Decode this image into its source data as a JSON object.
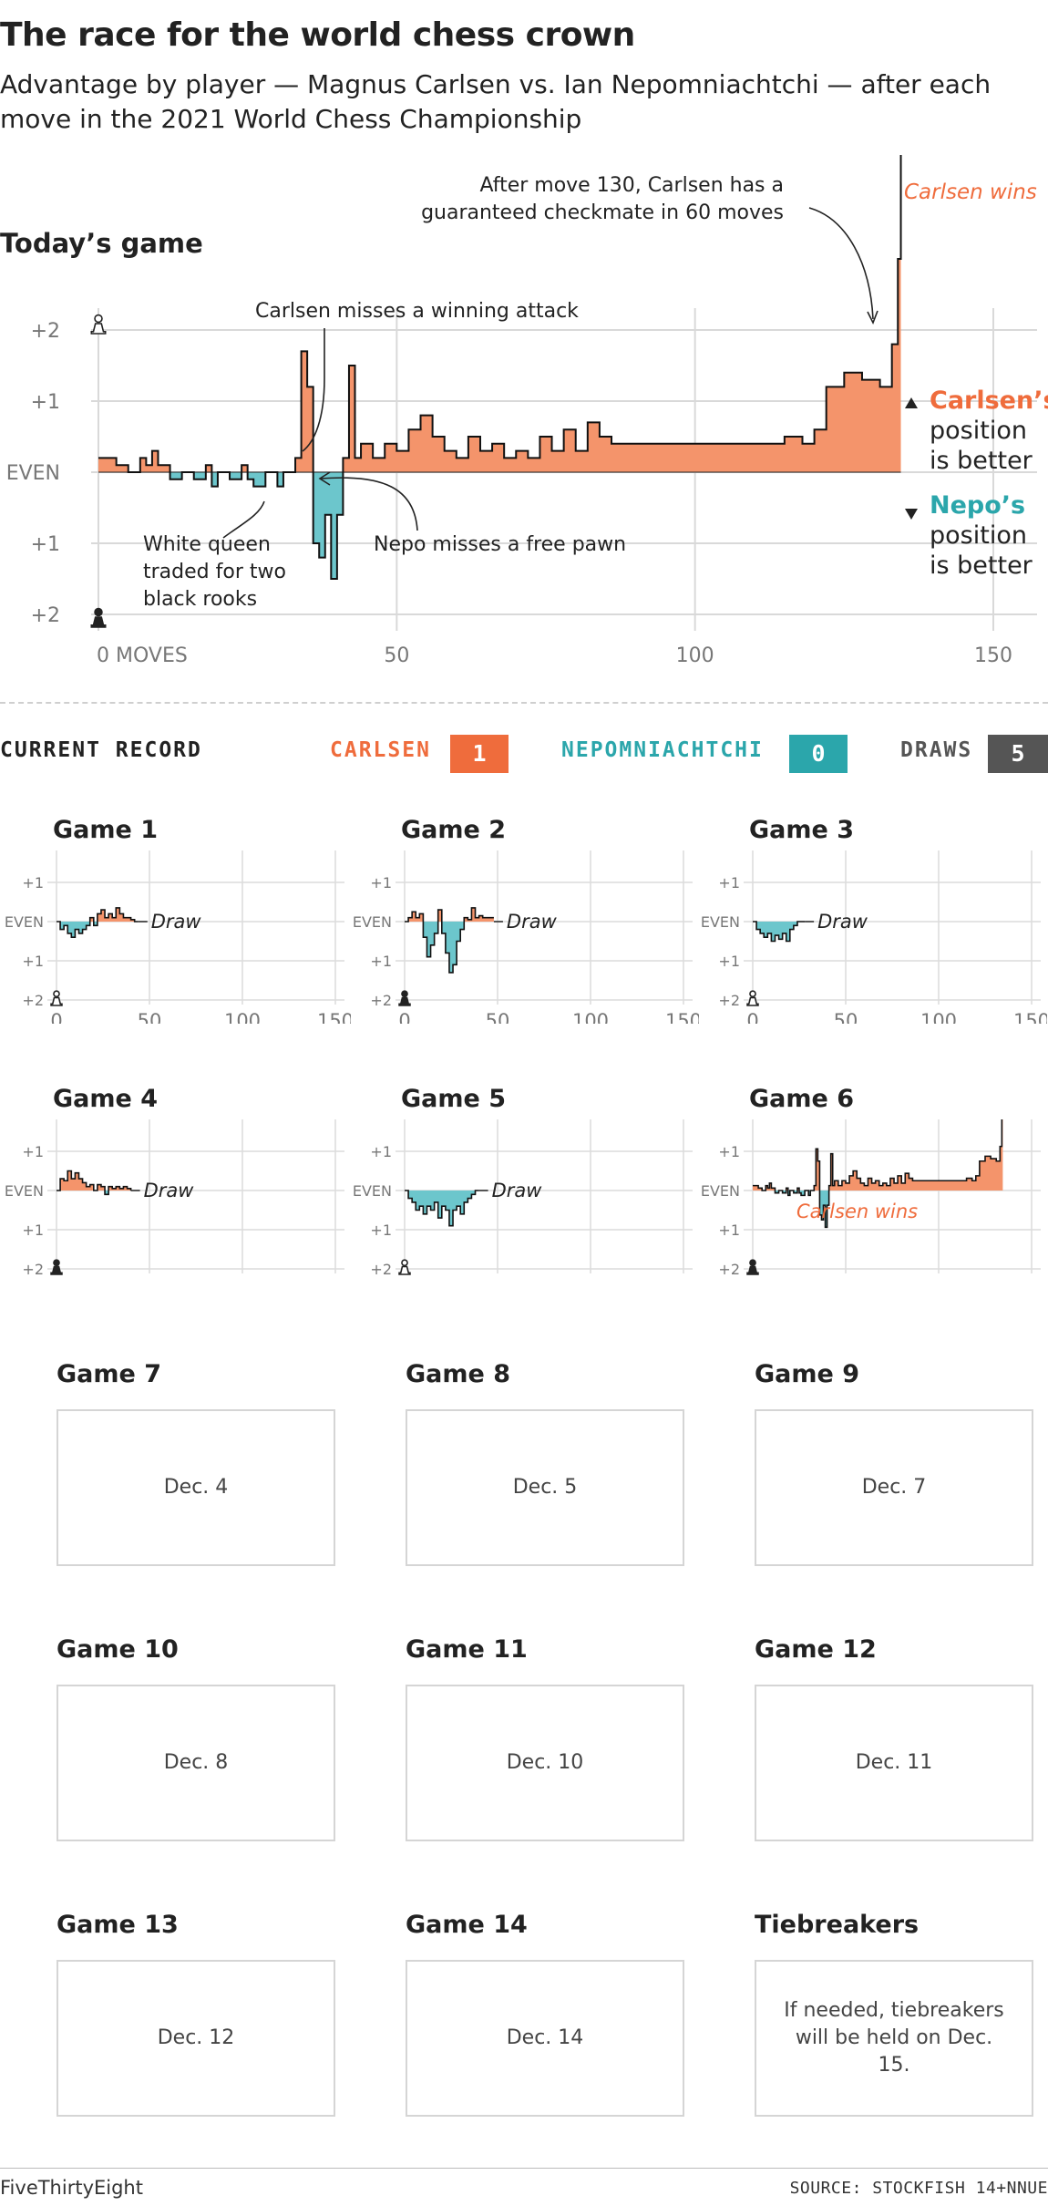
{
  "header": {
    "title": "The race for the world chess crown",
    "subtitle": "Advantage by player — Magnus Carlsen vs. Ian Nepomniachtchi — after each move in the 2021 World Chess Championship",
    "today_label": "Today’s game"
  },
  "colors": {
    "carlsen": "#f4946b",
    "carlsen_text": "#ef6c3c",
    "nepo": "#6cc6cc",
    "nepo_text": "#2ba6ab",
    "draw": "#555555"
  },
  "chart_data": {
    "type": "area",
    "title": "Today’s game",
    "xlabel": "MOVES",
    "x_ticks": [
      "0 MOVES",
      "50",
      "100",
      "150"
    ],
    "y_ticks": [
      "+2",
      "+1",
      "EVEN",
      "+1",
      "+2"
    ],
    "xlim": [
      0,
      150
    ],
    "ylim": [
      -2,
      2
    ],
    "legend_carlsen": [
      "Carlsen’s",
      "position",
      "is better"
    ],
    "legend_nepo": [
      "Nepo’s",
      "position",
      "is better"
    ],
    "result_label": "Carlsen wins",
    "annotations": {
      "checkmate": [
        "After move 130, Carlsen has a",
        "guaranteed checkmate in 60 moves"
      ],
      "missed_attack": "Carlsen misses a winning attack",
      "free_pawn": "Nepo misses a free pawn",
      "queen_trade": [
        "White queen",
        "traded for two",
        "black rooks"
      ]
    },
    "series": [
      {
        "values": [
          [
            0,
            0.2
          ],
          [
            3,
            0.1
          ],
          [
            5,
            0
          ],
          [
            7,
            0.2
          ],
          [
            8,
            0.1
          ],
          [
            9,
            0.3
          ],
          [
            10,
            0.1
          ],
          [
            12,
            -0.1
          ],
          [
            14,
            0
          ],
          [
            16,
            -0.1
          ],
          [
            18,
            0.1
          ],
          [
            19,
            -0.2
          ],
          [
            20,
            0
          ],
          [
            22,
            -0.1
          ],
          [
            24,
            0.1
          ],
          [
            25,
            -0.1
          ],
          [
            26,
            -0.2
          ],
          [
            28,
            0
          ],
          [
            30,
            -0.2
          ],
          [
            31,
            0
          ],
          [
            33,
            0.2
          ],
          [
            34,
            1.7
          ],
          [
            35,
            1.2
          ],
          [
            36,
            -1.0
          ],
          [
            37,
            -1.2
          ],
          [
            38,
            -0.6
          ],
          [
            39,
            -1.5
          ],
          [
            40,
            -0.6
          ],
          [
            41,
            0.2
          ],
          [
            42,
            1.5
          ],
          [
            43,
            0.2
          ],
          [
            44,
            0.4
          ],
          [
            46,
            0.2
          ],
          [
            48,
            0.4
          ],
          [
            50,
            0.3
          ],
          [
            52,
            0.6
          ],
          [
            54,
            0.8
          ],
          [
            56,
            0.5
          ],
          [
            58,
            0.3
          ],
          [
            60,
            0.2
          ],
          [
            62,
            0.5
          ],
          [
            64,
            0.3
          ],
          [
            66,
            0.4
          ],
          [
            68,
            0.2
          ],
          [
            70,
            0.3
          ],
          [
            72,
            0.2
          ],
          [
            74,
            0.5
          ],
          [
            76,
            0.3
          ],
          [
            78,
            0.6
          ],
          [
            80,
            0.3
          ],
          [
            82,
            0.7
          ],
          [
            84,
            0.5
          ],
          [
            86,
            0.4
          ],
          [
            90,
            0.4
          ],
          [
            95,
            0.4
          ],
          [
            100,
            0.4
          ],
          [
            105,
            0.4
          ],
          [
            110,
            0.4
          ],
          [
            115,
            0.5
          ],
          [
            118,
            0.4
          ],
          [
            120,
            0.6
          ],
          [
            122,
            1.2
          ],
          [
            125,
            1.4
          ],
          [
            128,
            1.3
          ],
          [
            131,
            1.2
          ],
          [
            133,
            1.8
          ],
          [
            134,
            3.0
          ],
          [
            134.5,
            4.5
          ]
        ]
      }
    ]
  },
  "record": {
    "label": "CURRENT RECORD",
    "carlsen_label": "CARLSEN",
    "carlsen_value": "1",
    "nepo_label": "NEPOMNIACHTCHI",
    "nepo_value": "0",
    "draws_label": "DRAWS",
    "draws_value": "5"
  },
  "small_axis": {
    "y_ticks": [
      "+2",
      "+1",
      "EVEN",
      "+1",
      "+2"
    ],
    "x_ticks": [
      "0",
      "50",
      "100",
      "150"
    ]
  },
  "games": [
    {
      "title": "Game 1",
      "result": "Draw",
      "white_top": false,
      "values": [
        0,
        -0.2,
        -0.1,
        -0.3,
        -0.4,
        -0.2,
        -0.3,
        -0.2,
        -0.1,
        0.1,
        -0.1,
        0.2,
        0.3,
        0.1,
        0.2,
        0.1,
        0.35,
        0.2,
        0.1,
        0.1,
        0.05,
        0,
        0
      ]
    },
    {
      "title": "Game 2",
      "result": "Draw",
      "white_top": true,
      "values": [
        0,
        0.1,
        0.25,
        0.1,
        0.2,
        -0.4,
        -0.9,
        -0.6,
        -0.3,
        0.3,
        -0.3,
        -0.8,
        -1.3,
        -1.1,
        -0.5,
        -0.2,
        0.1,
        0.05,
        0.35,
        0.1,
        0.15,
        0.1,
        0.1,
        0.1,
        0.1
      ]
    },
    {
      "title": "Game 3",
      "result": "Draw",
      "white_top": false,
      "values": [
        0,
        -0.2,
        -0.3,
        -0.4,
        -0.3,
        -0.5,
        -0.35,
        -0.45,
        -0.3,
        -0.5,
        -0.2,
        -0.1,
        0,
        0,
        0
      ]
    },
    {
      "title": "Game 4",
      "result": "Draw",
      "white_top": true,
      "values": [
        0,
        0.3,
        0.25,
        0.5,
        0.3,
        0.45,
        0.3,
        0.2,
        0.1,
        0.15,
        0,
        0.15,
        0.1,
        -0.1,
        0.1,
        0.05,
        0.1,
        0.05,
        0.1,
        0.05,
        0
      ]
    },
    {
      "title": "Game 5",
      "result": "Draw",
      "white_top": false,
      "values": [
        0,
        -0.2,
        -0.3,
        -0.5,
        -0.4,
        -0.6,
        -0.4,
        -0.5,
        -0.3,
        -0.7,
        -0.4,
        -0.5,
        -0.9,
        -0.5,
        -0.4,
        -0.6,
        -0.3,
        -0.2,
        -0.1,
        0,
        0
      ]
    },
    {
      "title": "Game 6",
      "result": "Carlsen wins",
      "white_top": true,
      "values": []
    }
  ],
  "future_games": [
    {
      "title": "Game 7",
      "date": "Dec. 4"
    },
    {
      "title": "Game 8",
      "date": "Dec. 5"
    },
    {
      "title": "Game 9",
      "date": "Dec. 7"
    },
    {
      "title": "Game 10",
      "date": "Dec. 8"
    },
    {
      "title": "Game 11",
      "date": "Dec. 10"
    },
    {
      "title": "Game 12",
      "date": "Dec. 11"
    },
    {
      "title": "Game 13",
      "date": "Dec. 12"
    },
    {
      "title": "Game 14",
      "date": "Dec. 14"
    },
    {
      "title": "Tiebreakers",
      "date": "If needed, tiebreakers will be held on Dec. 15."
    }
  ],
  "footer": {
    "brand": "FiveThirtyEight",
    "source": "SOURCE: STOCKFISH 14+NNUE"
  }
}
